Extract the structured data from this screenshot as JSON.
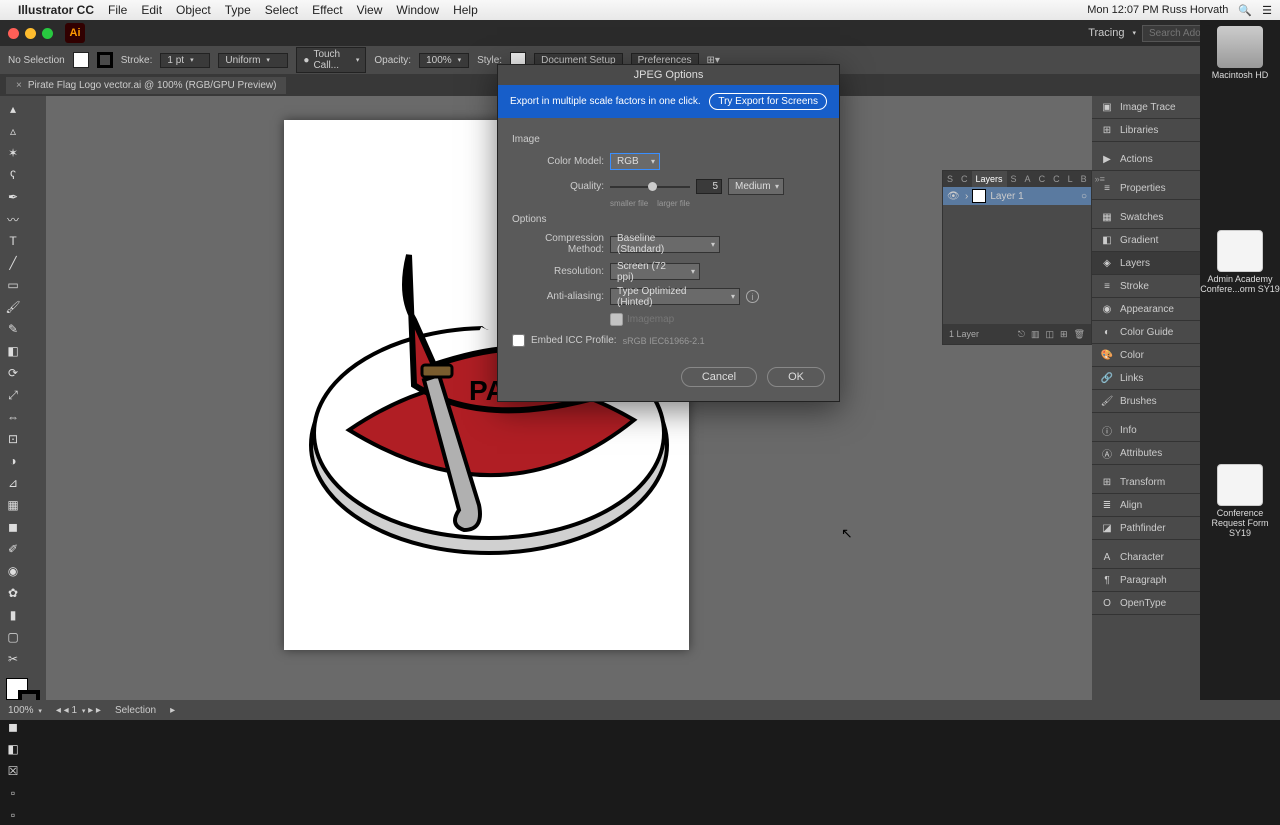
{
  "mac": {
    "app": "Illustrator CC",
    "menus": [
      "File",
      "Edit",
      "Object",
      "Type",
      "Select",
      "Effect",
      "View",
      "Window",
      "Help"
    ],
    "status_right": "Mon 12:07 PM  Russ Horvath"
  },
  "workspace": {
    "label": "Tracing",
    "search_placeholder": "Search Adobe Stock"
  },
  "control": {
    "no_selection": "No Selection",
    "stroke": "Stroke:",
    "stroke_val": "1 pt",
    "uniform": "Uniform",
    "brush": "Touch Call...",
    "opacity": "Opacity:",
    "opacity_val": "100%",
    "style": "Style:",
    "doc_setup": "Document Setup",
    "prefs": "Preferences"
  },
  "tab": {
    "name": "Pirate Flag Logo vector.ai @ 100% (RGB/GPU Preview)"
  },
  "dialog": {
    "title": "JPEG Options",
    "banner": "Export in multiple scale factors in one click.",
    "banner_btn": "Try Export for Screens",
    "image_hdr": "Image",
    "color_model_lbl": "Color Model:",
    "color_model": "RGB",
    "quality_lbl": "Quality:",
    "quality_val": "5",
    "quality_preset": "Medium",
    "smaller": "smaller file",
    "larger": "larger file",
    "options_hdr": "Options",
    "comp_lbl": "Compression Method:",
    "comp": "Baseline (Standard)",
    "res_lbl": "Resolution:",
    "res": "Screen (72 ppi)",
    "aa_lbl": "Anti-aliasing:",
    "aa": "Type Optimized (Hinted)",
    "imagemap": "Imagemap",
    "icc_lbl": "Embed ICC Profile:",
    "icc_profile": "sRGB IEC61966-2.1",
    "cancel": "Cancel",
    "ok": "OK"
  },
  "layers": {
    "tabs_left": [
      "S",
      "C"
    ],
    "active": "Layers",
    "tabs_right": [
      "S",
      "A",
      "C",
      "C",
      "L",
      "B"
    ],
    "row": "Layer 1",
    "footer": "1 Layer"
  },
  "panels": [
    "Image Trace",
    "Libraries",
    "Actions",
    "Properties",
    "Swatches",
    "Gradient",
    "Layers",
    "Stroke",
    "Appearance",
    "Color Guide",
    "Color",
    "Links",
    "Brushes",
    "Info",
    "Attributes",
    "Transform",
    "Align",
    "Pathfinder",
    "Character",
    "Paragraph",
    "OpenType"
  ],
  "status": {
    "zoom": "100%",
    "nav": "1",
    "mode": "Selection"
  },
  "desktop": {
    "hd": "Macintosh HD",
    "d1": "Admin Academy Confere...orm SY19",
    "d2": "Conference Request Form SY19"
  }
}
